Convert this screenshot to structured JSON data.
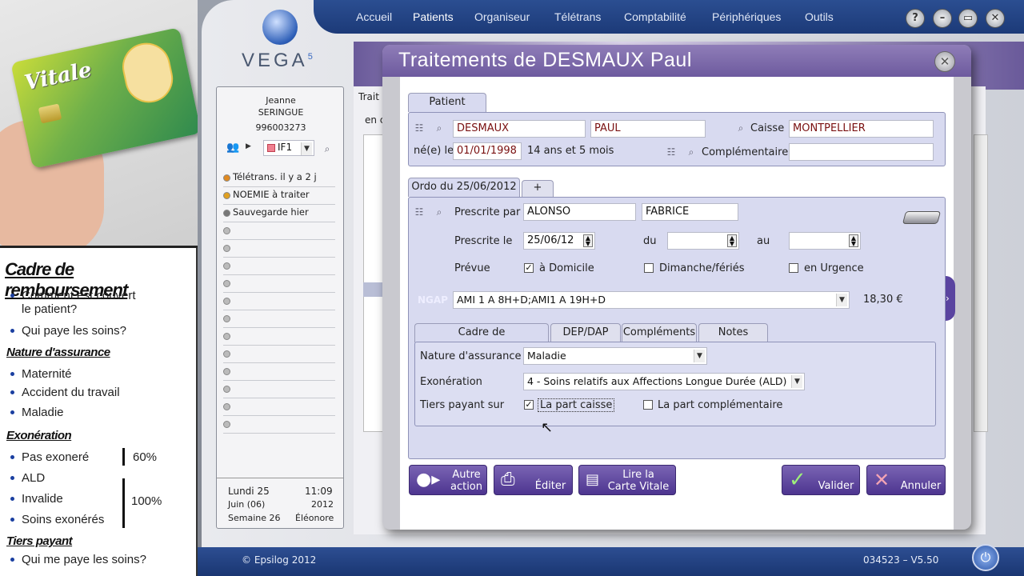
{
  "tutorial": {
    "title": "Cadre de remboursement",
    "q1": "Comment est couvert",
    "q1b": "le patient?",
    "q2": "Qui paye les soins?",
    "nature_title": "Nature d'assurance",
    "nature": [
      "Maternité",
      "Accident du travail",
      "Maladie"
    ],
    "exo_title": "Exonération",
    "exo": [
      "Pas exoneré",
      "ALD",
      "Invalide",
      "Soins exonérés"
    ],
    "pct60": "60%",
    "pct100": "100%",
    "tiers_title": "Tiers payant",
    "tiers_q": "Qui me paye les soins?",
    "card_text": "Vitale"
  },
  "app": {
    "logo": "VEGA",
    "logo_sup": "5",
    "nav": [
      "Accueil",
      "Patients",
      "Organiseur",
      "Télétrans",
      "Comptabilité",
      "Périphériques",
      "Outils"
    ],
    "active_nav": "Patients",
    "window_buttons": [
      "?",
      "–",
      "▭",
      "✕"
    ]
  },
  "sidebar": {
    "user_first": "Jeanne",
    "user_last": "SERINGUE",
    "user_id": "996003273",
    "selector": "IF1",
    "alerts": [
      {
        "label": "Télétrans. il y a 2 j",
        "color": "#e08a20"
      },
      {
        "label": "NOEMIE à traiter",
        "color": "#e0a020"
      },
      {
        "label": "Sauvegarde hier",
        "color": "#777777"
      }
    ],
    "day": "Lundi 25",
    "time": "11:09",
    "month": "Juin (06)",
    "year": "2012",
    "week": "Semaine 26",
    "saint": "Éléonore"
  },
  "behind": {
    "tab_label": "Trait",
    "field": "en c"
  },
  "dialog": {
    "title": "Traitements de DESMAUX Paul",
    "patient_tab": "Patient",
    "last_name": "DESMAUX",
    "first_name": "PAUL",
    "caisse_label": "Caisse",
    "caisse": "MONTPELLIER",
    "birth_label": "né(e) le",
    "birth_date": "01/01/1998",
    "age": "14 ans et 5 mois",
    "complementaire_label": "Complémentaire",
    "complementaire": "",
    "ordo_tab": "Ordo du 25/06/2012",
    "add_tab": "+",
    "prescrite_par_label": "Prescrite par",
    "prescriber_last": "ALONSO",
    "prescriber_first": "FABRICE",
    "prescrite_le_label": "Prescrite le",
    "prescrite_le": "25/06/12",
    "du_label": "du",
    "du": "",
    "au_label": "au",
    "au": "",
    "prevue_label": "Prévue",
    "domicile_label": "à Domicile",
    "domicile": true,
    "dimanche_label": "Dimanche/fériés",
    "dimanche": false,
    "urgence_label": "en Urgence",
    "urgence": false,
    "ngap_label": "NGAP",
    "ngap": "AMI 1 A 8H+D;AMI1 A 19H+D",
    "amount": "18,30 €",
    "sub_tabs": [
      "Cadre de remboursement",
      "DEP/DAP",
      "Compléments",
      "Notes"
    ],
    "nature_label": "Nature d'assurance",
    "nature": "Maladie",
    "exo_label": "Exonération",
    "exo": "4 - Soins relatifs aux Affections Longue Durée (ALD)",
    "tiers_label": "Tiers payant sur",
    "part_caisse_label": "La part caisse",
    "part_caisse": true,
    "part_comp_label": "La part complémentaire",
    "part_comp": false
  },
  "buttons": {
    "autre_1": "Autre",
    "autre_2": "action",
    "editer": "Éditer",
    "lire_1": "Lire la",
    "lire_2": "Carte Vitale",
    "valider": "Valider",
    "annuler": "Annuler"
  },
  "status": {
    "copyright": "© Epsilog 2012",
    "version": "034523 – V5.50"
  }
}
